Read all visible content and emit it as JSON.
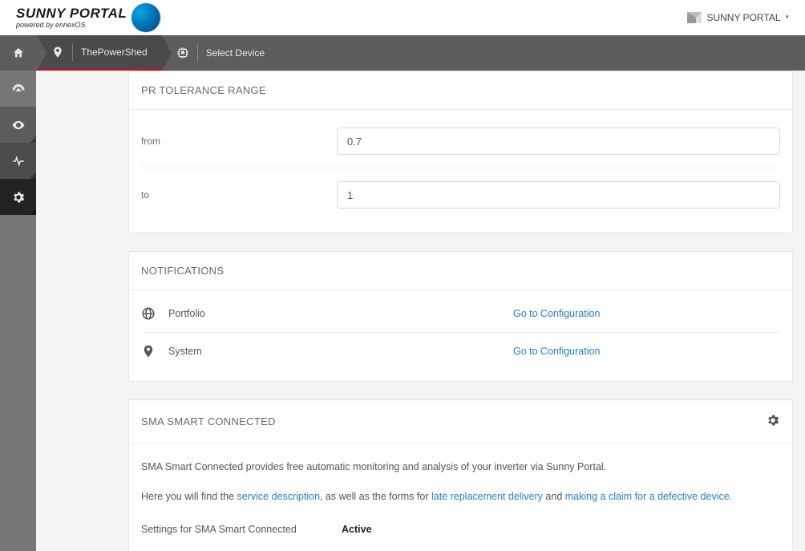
{
  "header": {
    "logo_main": "SUNNY PORTAL",
    "logo_sub": "powered by ennexOS",
    "portal_label": "SUNNY PORTAL"
  },
  "breadcrumbs": {
    "system_name": "ThePowerShed",
    "select_device": "Select Device"
  },
  "panels": {
    "pr": {
      "title": "PR TOLERANCE RANGE",
      "from_label": "from",
      "from_value": "0.7",
      "to_label": "to",
      "to_value": "1"
    },
    "notifications": {
      "title": "NOTIFICATIONS",
      "rows": [
        {
          "label": "Portfolio",
          "link": "Go to Configuration"
        },
        {
          "label": "System",
          "link": "Go to Configuration"
        }
      ]
    },
    "smart": {
      "title": "SMA SMART CONNECTED",
      "line1": "SMA Smart Connected provides free automatic monitoring and analysis of your inverter via Sunny Portal.",
      "line2_a": "Here you will find the ",
      "link1": "service description",
      "line2_b": ", as well as the forms for ",
      "link2": "late replacement delivery",
      "line2_c": " and ",
      "link3": "making a claim for a defective device.",
      "setting_label": "Settings for SMA Smart Connected",
      "setting_value": "Active"
    }
  }
}
